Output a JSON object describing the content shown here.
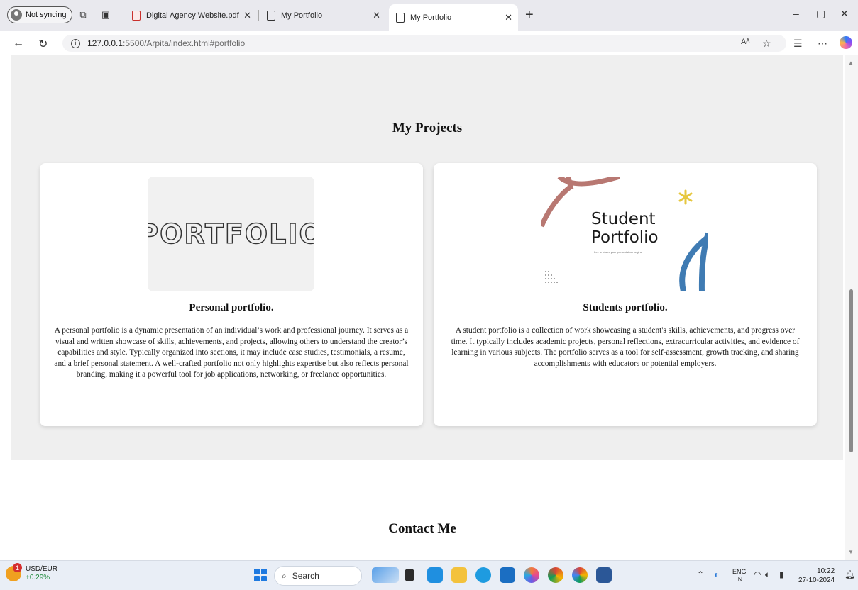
{
  "browser": {
    "profile_label": "Not syncing",
    "tabs": [
      {
        "label": "Digital Agency Website.pdf",
        "active": false
      },
      {
        "label": "My Portfolio",
        "active": false
      },
      {
        "label": "My Portfolio",
        "active": true
      }
    ],
    "url": {
      "host": "127.0.0.1",
      "rest": ":5500/Arpita/index.html#portfolio"
    }
  },
  "page": {
    "projects_title": "My Projects",
    "projects": [
      {
        "image_text": "PORTFOLIO",
        "title": "Personal portfolio.",
        "description": "A personal portfolio is a dynamic presentation of an individual’s work and professional journey. It serves as a visual and written showcase of skills, achievements, and projects, allowing others to understand the creator’s capabilities and style. Typically organized into sections, it may include case studies, testimonials, a resume, and a brief personal statement. A well-crafted portfolio not only highlights expertise but also reflects personal branding, making it a powerful tool for job applications, networking, or freelance opportunities."
      },
      {
        "image_text_line1": "Student",
        "image_text_line2": "Portfolio",
        "image_subtext": "Here is where your presentation begins",
        "title": "Students portfolio.",
        "description": "A student portfolio is a collection of work showcasing a student's skills, achievements, and progress over time. It typically includes academic projects, personal reflections, extracurricular activities, and evidence of learning in various subjects. The portfolio serves as a tool for self-assessment, growth tracking, and sharing accomplishments with educators or potential employers."
      }
    ],
    "contact_title": "Contact Me"
  },
  "taskbar": {
    "widget_title": "USD/EUR",
    "widget_change": "+0.29%",
    "widget_badge": "1",
    "search_label": "Search",
    "lang_line1": "ENG",
    "lang_line2": "IN",
    "time": "10:22",
    "date": "27-10-2024"
  },
  "colors": {
    "page_bg": "#efefef",
    "card_bg": "#ffffff",
    "accent_blue": "#1f7ae0"
  }
}
